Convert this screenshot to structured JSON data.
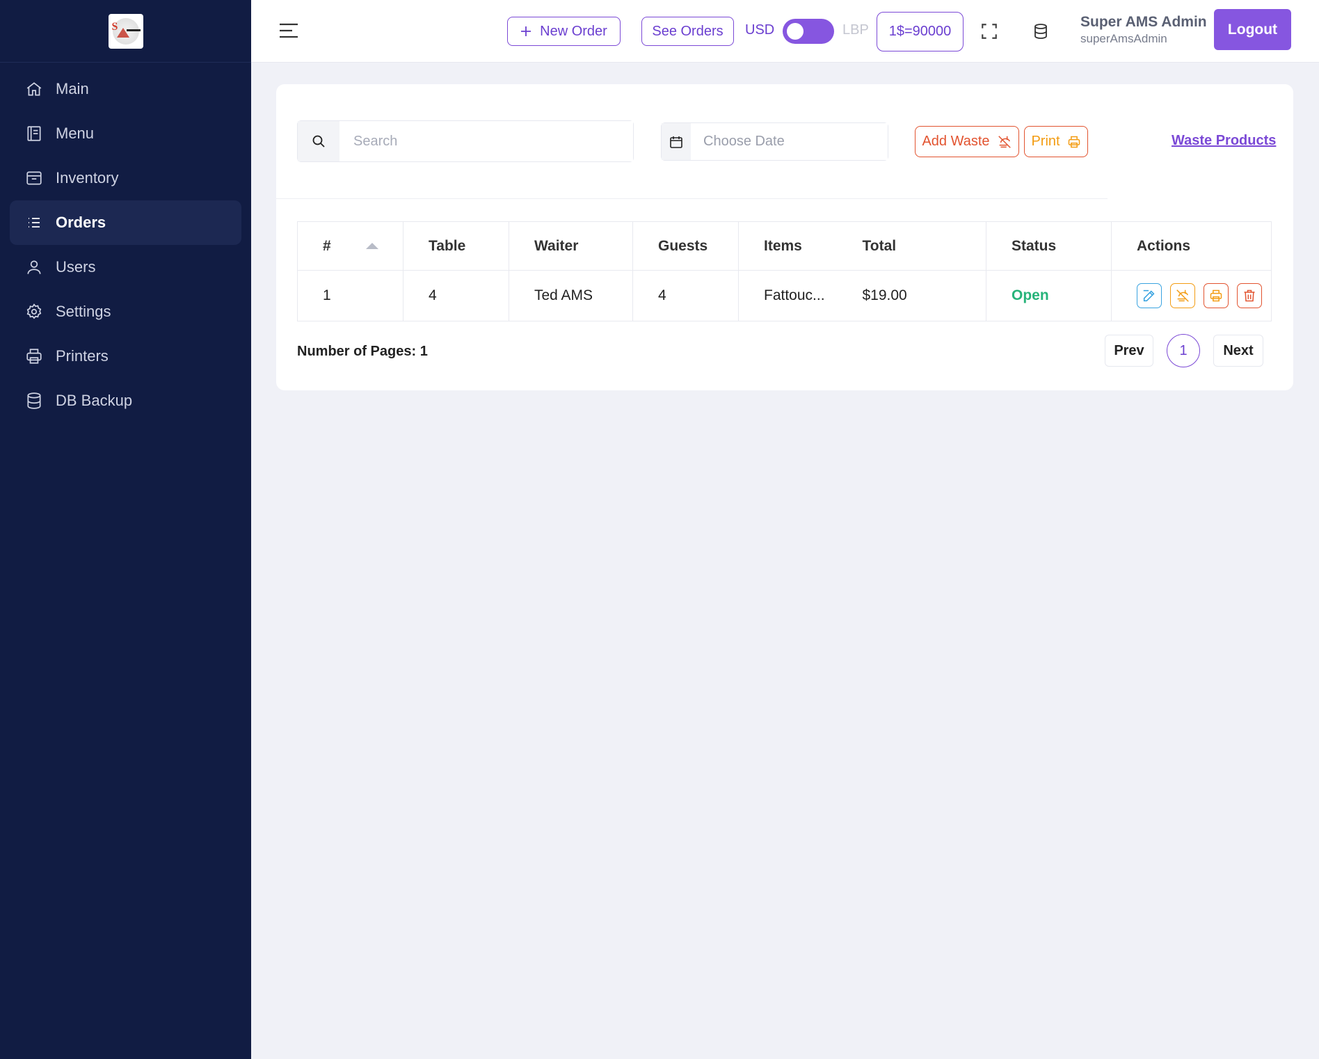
{
  "sidebar": {
    "items": [
      {
        "label": "Main",
        "icon": "home-icon",
        "active": false
      },
      {
        "label": "Menu",
        "icon": "book-icon",
        "active": false
      },
      {
        "label": "Inventory",
        "icon": "archive-icon",
        "active": false
      },
      {
        "label": "Orders",
        "icon": "list-icon",
        "active": true
      },
      {
        "label": "Users",
        "icon": "user-icon",
        "active": false
      },
      {
        "label": "Settings",
        "icon": "gear-icon",
        "active": false
      },
      {
        "label": "Printers",
        "icon": "printer-icon",
        "active": false
      },
      {
        "label": "DB Backup",
        "icon": "database-icon",
        "active": false
      }
    ]
  },
  "header": {
    "new_order_label": "New Order",
    "see_orders_label": "See Orders",
    "currency_left": "USD",
    "currency_right": "LBP",
    "rate": "1$=90000",
    "user_name": "Super AMS Admin",
    "user_handle": "superAmsAdmin",
    "logout_label": "Logout"
  },
  "toolbar": {
    "search_placeholder": "Search",
    "date_placeholder": "Choose Date",
    "add_waste_label": "Add Waste",
    "print_label": "Print",
    "waste_products_link": "Waste Products"
  },
  "table": {
    "columns": [
      "#",
      "Table",
      "Waiter",
      "Guests",
      "Items",
      "Total",
      "Status",
      "Actions"
    ],
    "rows": [
      {
        "num": "1",
        "table": "4",
        "waiter": "Ted AMS",
        "guests": "4",
        "items": "Fattouc...",
        "total": "$19.00",
        "status": "Open"
      }
    ]
  },
  "pagination": {
    "pages_info": "Number of Pages: 1",
    "prev": "Prev",
    "current": "1",
    "next": "Next"
  },
  "colors": {
    "sidebar_bg": "#111c43",
    "accent": "#8656e0",
    "status_open": "#27b37a",
    "danger": "#e2532f",
    "warning": "#f39c12",
    "info": "#39a3e0"
  }
}
